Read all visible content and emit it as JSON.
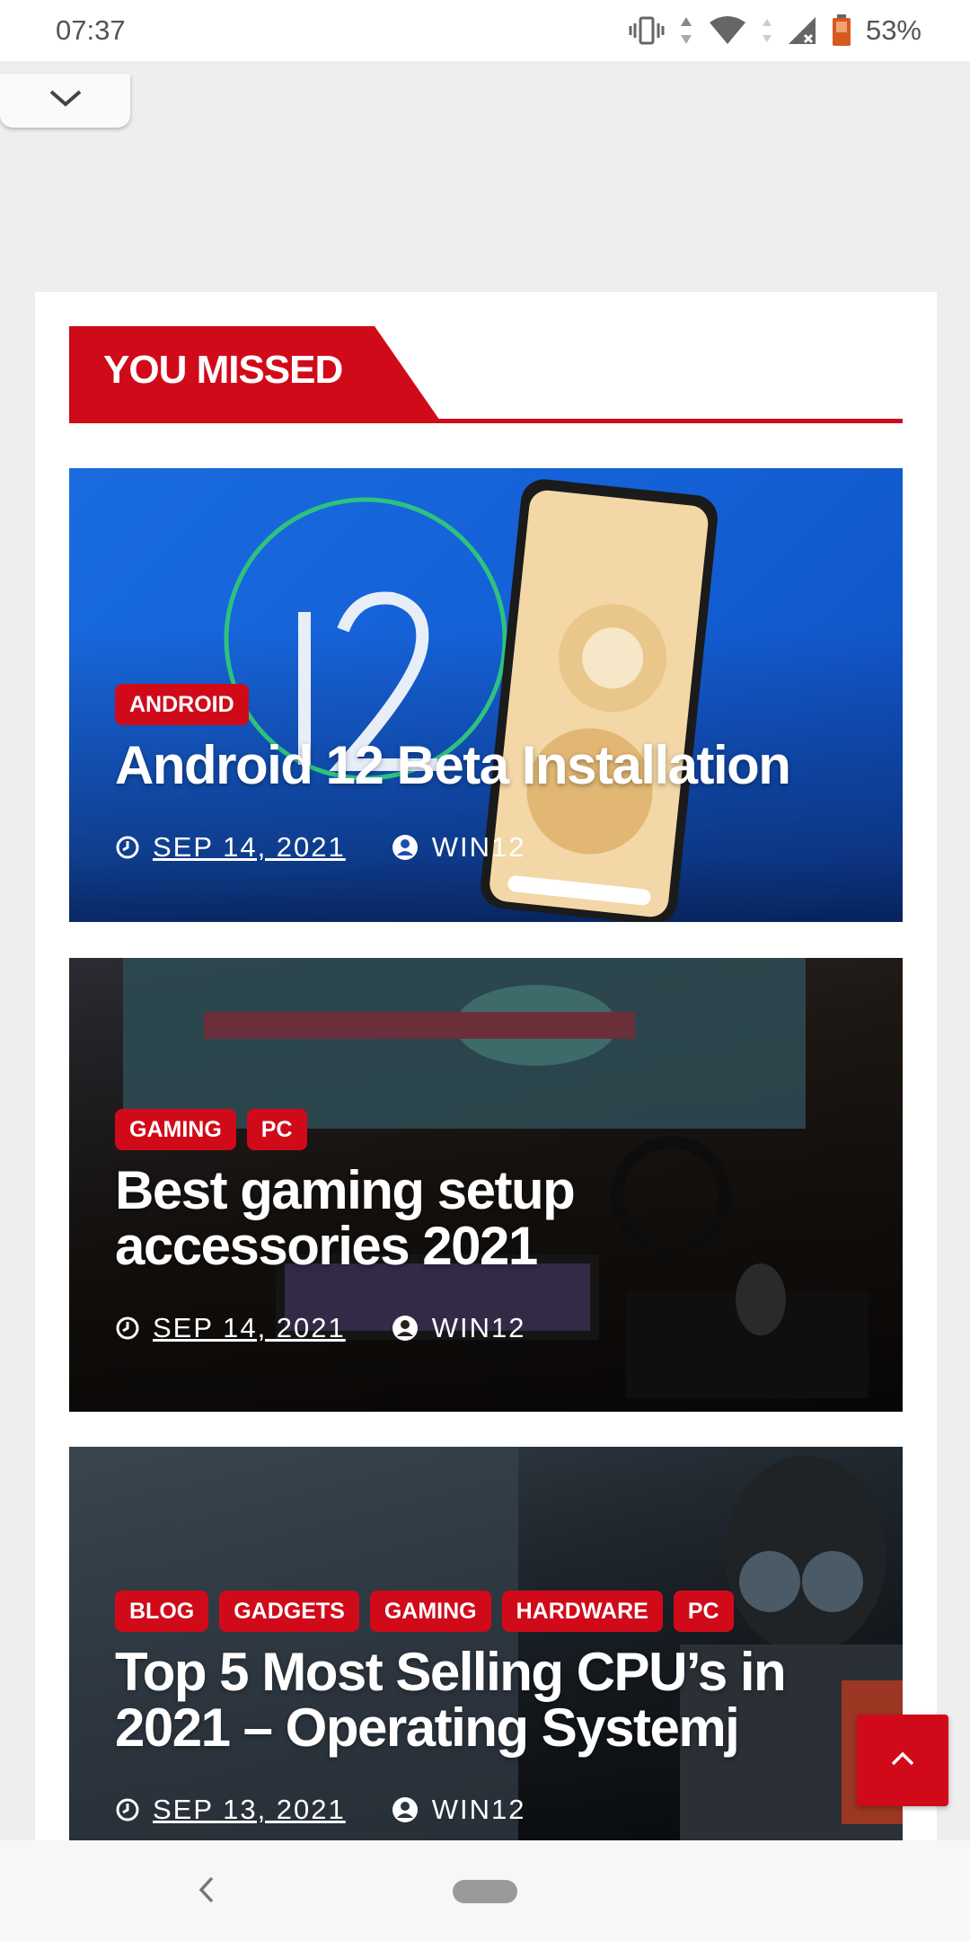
{
  "status_bar": {
    "time": "07:37",
    "battery": "53%",
    "icons": [
      "vibrate-icon",
      "data-arrows-icon",
      "wifi-icon",
      "signal-icon",
      "battery-icon"
    ]
  },
  "section": {
    "title": "YOU MISSED"
  },
  "posts": [
    {
      "tags": [
        "ANDROID"
      ],
      "title": "Android 12 Beta Installation",
      "date": "SEP 14, 2021",
      "author": "WIN12"
    },
    {
      "tags": [
        "GAMING",
        "PC"
      ],
      "title": "Best gaming setup accessories 2021",
      "date": "SEP 14, 2021",
      "author": "WIN12"
    },
    {
      "tags": [
        "BLOG",
        "GADGETS",
        "GAMING",
        "HARDWARE",
        "PC"
      ],
      "title": "Top 5 Most Selling CPU’s in 2021 – Operating Systemj",
      "date": "SEP 13, 2021",
      "author": "WIN12"
    }
  ],
  "colors": {
    "accent": "#d10a1a",
    "card_bg": "#ffffff",
    "page_bg": "#eeeeef"
  },
  "icons": {
    "collapse": "chevron-down-icon",
    "scroll_top": "chevron-up-icon",
    "date": "clock-icon",
    "author": "user-icon",
    "nav_back": "back-icon"
  }
}
